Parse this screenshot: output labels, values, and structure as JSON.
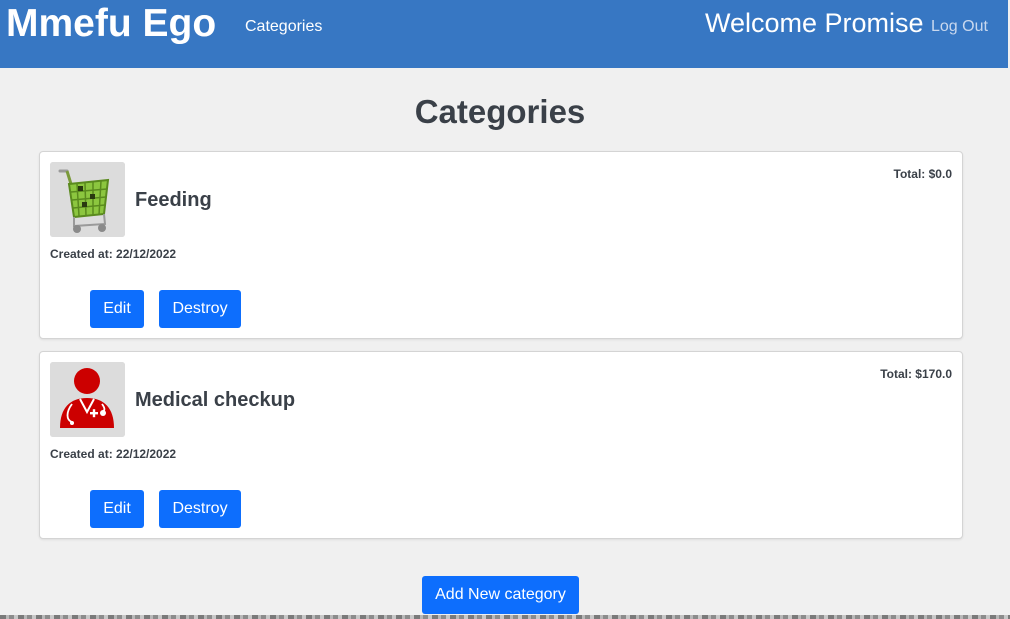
{
  "header": {
    "brand": "Mmefu Ego",
    "nav_link": "Categories",
    "welcome": "Welcome Promise",
    "logout": "Log Out",
    "background_color": "#3777c3"
  },
  "page": {
    "title": "Categories"
  },
  "categories": [
    {
      "name": "Feeding",
      "total": "Total: $0.0",
      "created": "Created at: 22/12/2022",
      "icon": "shopping-cart-icon",
      "edit_label": "Edit",
      "destroy_label": "Destroy"
    },
    {
      "name": "Medical checkup",
      "total": "Total: $170.0",
      "created": "Created at: 22/12/2022",
      "icon": "doctor-icon",
      "edit_label": "Edit",
      "destroy_label": "Destroy"
    }
  ],
  "actions": {
    "add_label": "Add New category",
    "button_color": "#0d6efd"
  }
}
